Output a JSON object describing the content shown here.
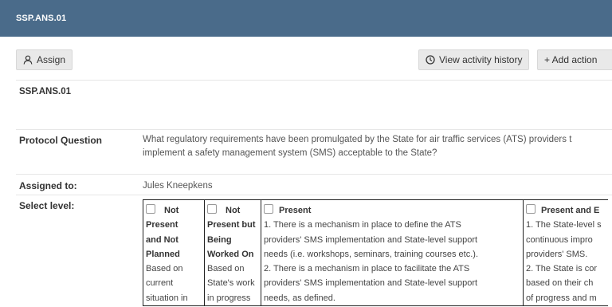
{
  "header": {
    "title": "SSP.ANS.01"
  },
  "toolbar": {
    "assign_label": "Assign",
    "history_label": "View activity history",
    "add_action_label": "+ Add action"
  },
  "record": {
    "id": "SSP.ANS.01",
    "protocol_question_label": "Protocol Question",
    "protocol_question_line1": "What regulatory requirements have been promulgated by the State for air traffic services (ATS) providers t",
    "protocol_question_line2": "implement a safety management system (SMS) acceptable to the State?",
    "assigned_label": "Assigned to:",
    "assigned_value": "Jules Kneepkens",
    "select_level_label": "Select level:"
  },
  "levels": [
    {
      "title_lines": [
        "Not",
        "Present",
        "and Not",
        "Planned"
      ],
      "desc": "Based on\ncurrent\nsituation in"
    },
    {
      "title_lines": [
        "Not",
        "Present but",
        "Being",
        "Worked On"
      ],
      "desc": "Based on\nState's work\nin progress"
    },
    {
      "title_lines": [
        "Present"
      ],
      "desc": "1. There is a mechanism in place to define the ATS\nproviders' SMS implementation and State-level support\nneeds (i.e. workshops, seminars, training courses etc.).\n2. There is a mechanism in place to facilitate the ATS\nproviders' SMS implementation and State-level support\nneeds, as defined."
    },
    {
      "title_lines": [
        "Present and E"
      ],
      "desc": "1. The State-level s\ncontinuous impro\nproviders' SMS.\n2. The State is cor\nbased on their ch\nof progress and m"
    }
  ]
}
